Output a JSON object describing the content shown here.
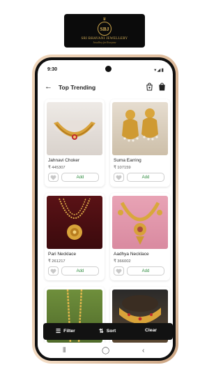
{
  "brand": {
    "monogram": "SBJ",
    "name": "SRI BHAVANI JEWELLERY",
    "tagline": "Jewellery for Everyone"
  },
  "status_bar": {
    "time": "9:30",
    "icons": "▾◢▮"
  },
  "app_bar": {
    "title": "Top Trending"
  },
  "products": [
    {
      "name": "Jahnavi Choker",
      "price": "₹ 445307",
      "add_label": "Add"
    },
    {
      "name": "Suma Earring",
      "price": "₹ 107159",
      "add_label": "Add"
    },
    {
      "name": "Pari Necklace",
      "price": "₹ 261217",
      "add_label": "Add"
    },
    {
      "name": "Aadhya Necklace",
      "price": "₹ 366002",
      "add_label": "Add"
    }
  ],
  "bottom_bar": {
    "filter_label": "Filter",
    "sort_label": "Sort",
    "clear_label": "Clear"
  },
  "colors": {
    "accent_green": "#2e8b3e",
    "gold": "#c9a24a",
    "bar_dark": "#121212"
  }
}
